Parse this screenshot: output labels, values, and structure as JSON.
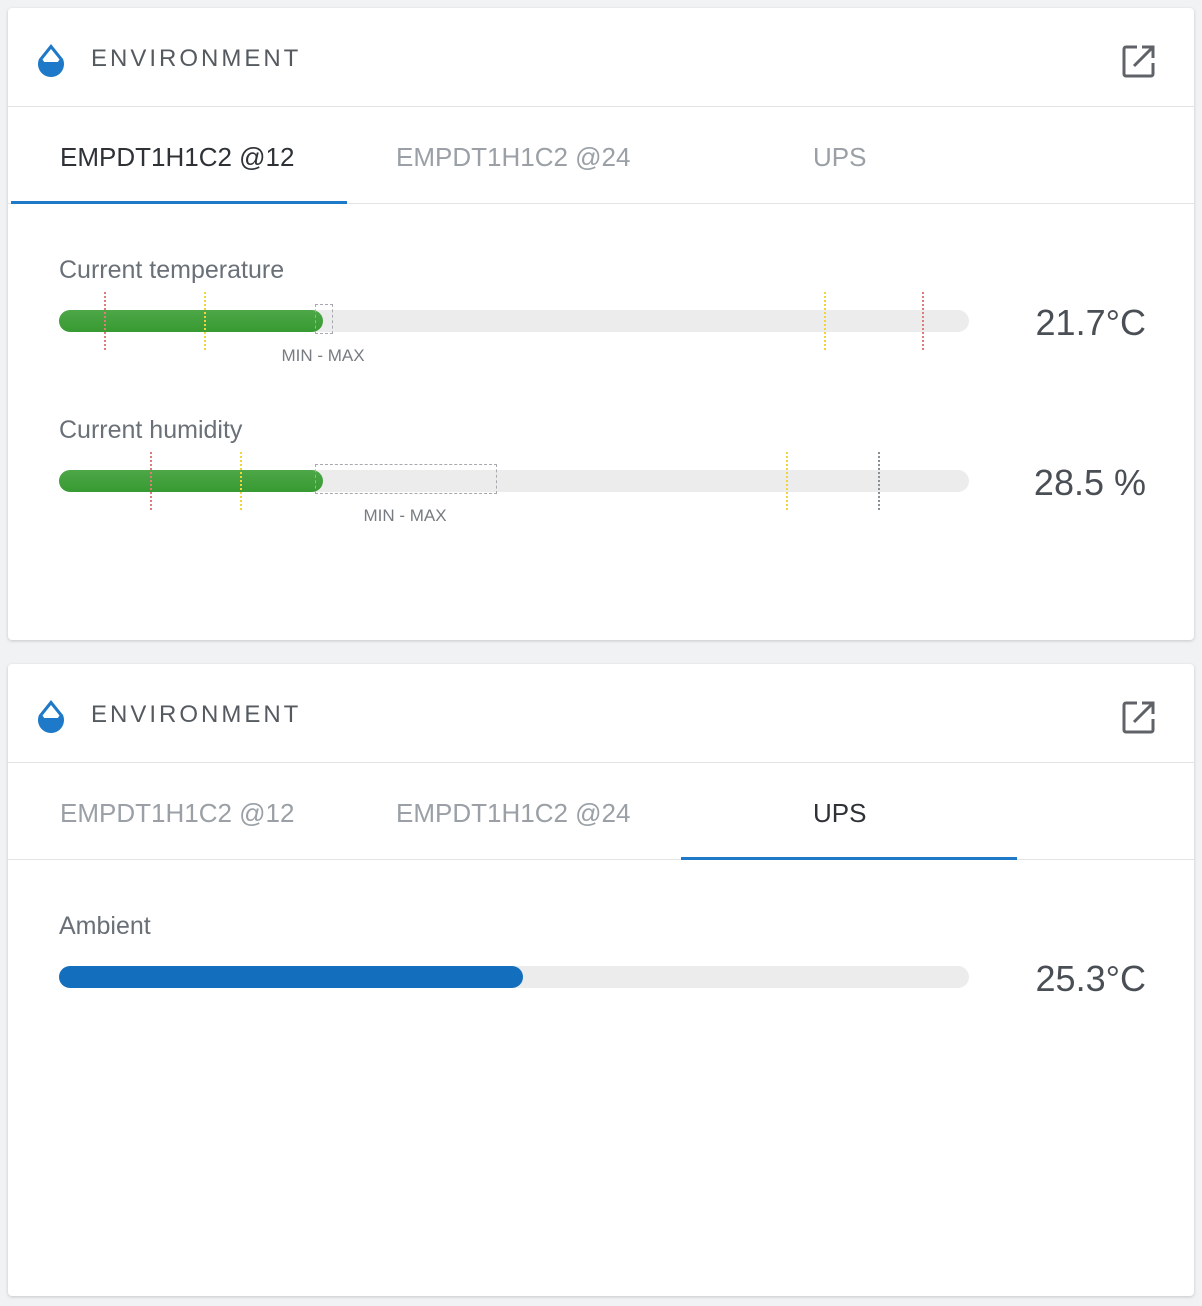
{
  "colors": {
    "accent": "#1e7ac8",
    "ok_green": "#3a9c35",
    "ups_blue": "#136fbd",
    "critical_marker": "#e07b7b",
    "warning_marker": "#f2d53c"
  },
  "cards": [
    {
      "title": "ENVIRONMENT",
      "header_icon": "water-drop-icon",
      "action_icon": "open-external-icon",
      "tabs": [
        {
          "label": "EMPDT1H1C2 @12",
          "active": true
        },
        {
          "label": "EMPDT1H1C2 @24",
          "active": false
        },
        {
          "label": "UPS",
          "active": false
        }
      ],
      "metrics": [
        {
          "label": "Current temperature",
          "value": "21.7°C",
          "fill_fraction": 0.29,
          "color": "green",
          "minmax_label": "MIN - MAX"
        },
        {
          "label": "Current humidity",
          "value": "28.5 %",
          "fill_fraction": 0.29,
          "color": "green",
          "minmax_label": "MIN - MAX"
        }
      ]
    },
    {
      "title": "ENVIRONMENT",
      "header_icon": "water-drop-icon",
      "action_icon": "open-external-icon",
      "tabs": [
        {
          "label": "EMPDT1H1C2 @12",
          "active": false
        },
        {
          "label": "EMPDT1H1C2 @24",
          "active": false
        },
        {
          "label": "UPS",
          "active": true
        }
      ],
      "metrics": [
        {
          "label": "Ambient",
          "value": "25.3°C",
          "fill_fraction": 0.51,
          "color": "blue"
        }
      ]
    }
  ]
}
